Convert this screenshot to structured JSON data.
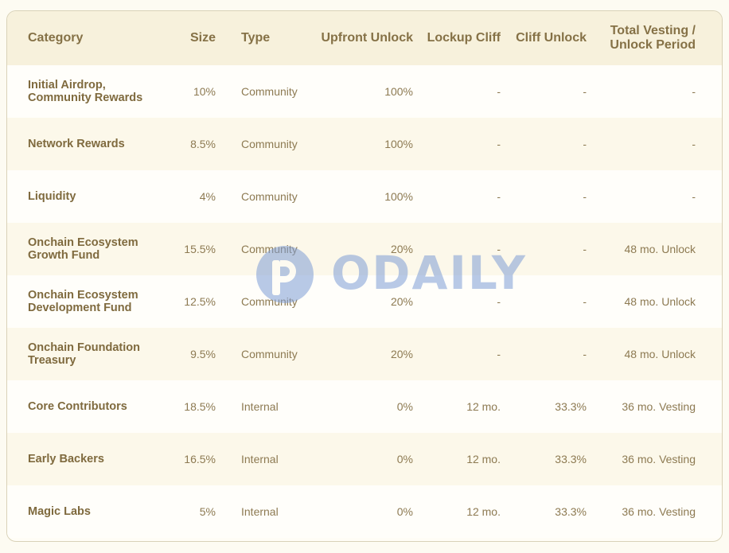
{
  "table": {
    "headers": {
      "category": "Category",
      "size": "Size",
      "type": "Type",
      "upfront": "Upfront Unlock",
      "lockup": "Lockup Cliff",
      "cliff_unlock": "Cliff Unlock",
      "total_line1": "Total Vesting /",
      "total_line2": "Unlock Period"
    },
    "rows": [
      {
        "category_l1": "Initial Airdrop,",
        "category_l2": "Community Rewards",
        "size": "10%",
        "type": "Community",
        "upfront": "100%",
        "lockup": "-",
        "cliff_unlock": "-",
        "total": "-"
      },
      {
        "category_l1": "Network Rewards",
        "category_l2": "",
        "size": "8.5%",
        "type": "Community",
        "upfront": "100%",
        "lockup": "-",
        "cliff_unlock": "-",
        "total": "-"
      },
      {
        "category_l1": "Liquidity",
        "category_l2": "",
        "size": "4%",
        "type": "Community",
        "upfront": "100%",
        "lockup": "-",
        "cliff_unlock": "-",
        "total": "-"
      },
      {
        "category_l1": "Onchain Ecosystem",
        "category_l2": "Growth Fund",
        "size": "15.5%",
        "type": "Community",
        "upfront": "20%",
        "lockup": "-",
        "cliff_unlock": "-",
        "total": "48 mo. Unlock"
      },
      {
        "category_l1": "Onchain Ecosystem",
        "category_l2": "Development Fund",
        "size": "12.5%",
        "type": "Community",
        "upfront": "20%",
        "lockup": "-",
        "cliff_unlock": "-",
        "total": "48 mo. Unlock"
      },
      {
        "category_l1": "Onchain Foundation",
        "category_l2": "Treasury",
        "size": "9.5%",
        "type": "Community",
        "upfront": "20%",
        "lockup": "-",
        "cliff_unlock": "-",
        "total": "48 mo. Unlock"
      },
      {
        "category_l1": "Core Contributors",
        "category_l2": "",
        "size": "18.5%",
        "type": "Internal",
        "upfront": "0%",
        "lockup": "12 mo.",
        "cliff_unlock": "33.3%",
        "total": "36 mo. Vesting"
      },
      {
        "category_l1": "Early Backers",
        "category_l2": "",
        "size": "16.5%",
        "type": "Internal",
        "upfront": "0%",
        "lockup": "12 mo.",
        "cliff_unlock": "33.3%",
        "total": "36 mo. Vesting"
      },
      {
        "category_l1": "Magic Labs",
        "category_l2": "",
        "size": "5%",
        "type": "Internal",
        "upfront": "0%",
        "lockup": "12 mo.",
        "cliff_unlock": "33.3%",
        "total": "36 mo. Vesting"
      }
    ]
  },
  "watermark": {
    "text": "ODAILY",
    "color": "#7f9ed6",
    "icon": "odaily-logo-icon"
  }
}
